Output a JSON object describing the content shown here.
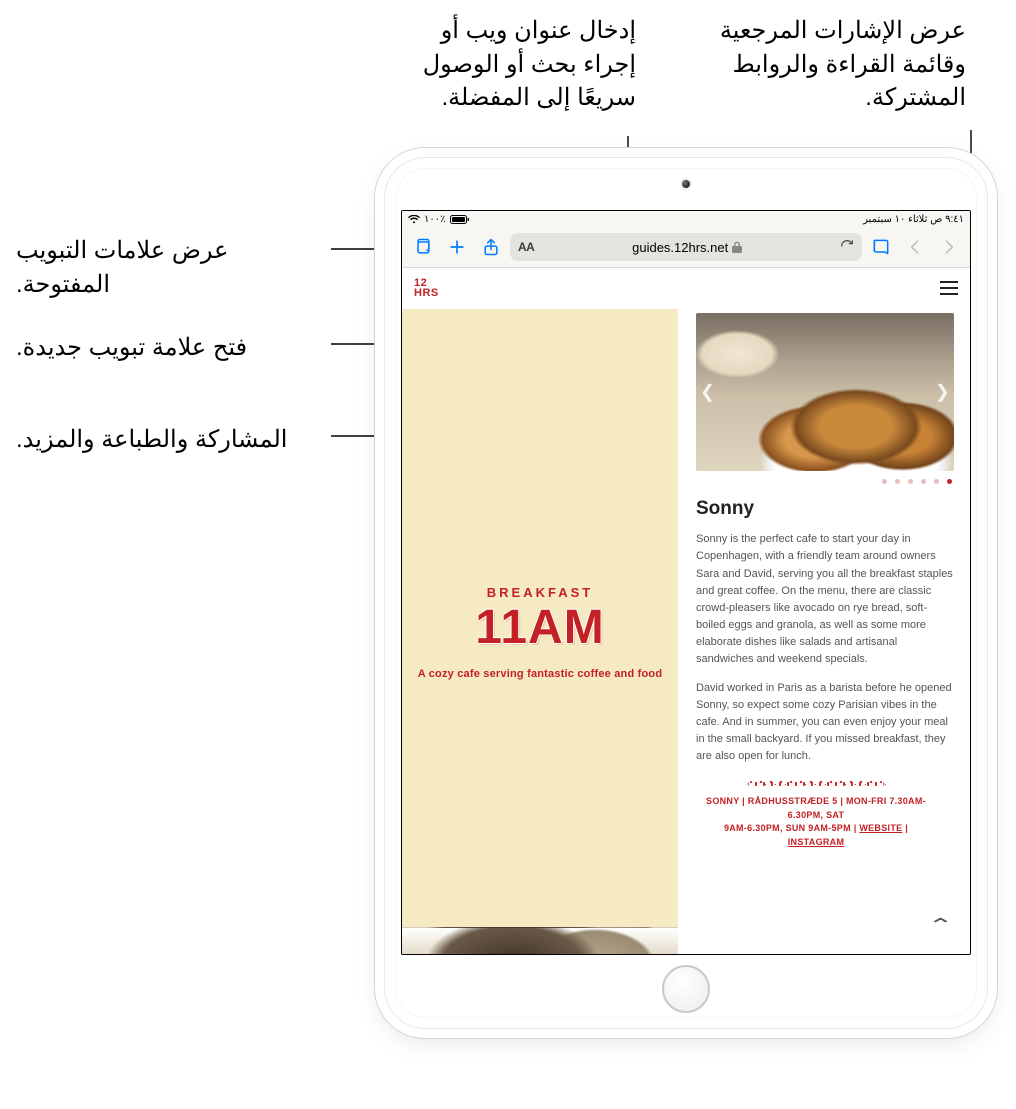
{
  "callouts": {
    "bookmarks": "عرض الإشارات المرجعية وقائمة القراءة والروابط المشتركة.",
    "urlbar": "إدخال عنوان ويب أو إجراء بحث أو الوصول سريعًا إلى المفضلة.",
    "tabs": "عرض علامات التبويب المفتوحة.",
    "newtab": "فتح علامة تبويب جديدة.",
    "share": "المشاركة والطباعة والمزيد."
  },
  "status": {
    "time": "٩:٤١ ص  ثلاثاء ١٠ سبتمبر",
    "battery": "١٠٠٪"
  },
  "urlbar": {
    "aa": "AA",
    "address": "guides.12hrs.net"
  },
  "site": {
    "logo_top": "12",
    "logo_bottom": "HRS"
  },
  "left": {
    "tag": "BREAKFAST",
    "headline": "11AM",
    "sub": "A cozy cafe serving fantastic coffee and food"
  },
  "article": {
    "title": "Sonny",
    "p1": "Sonny is the perfect cafe to start your day in Copenhagen, with a friendly team around owners Sara and David, serving you all the breakfast staples and great coffee. On the menu, there are classic crowd-pleasers like avocado on rye bread, soft-boiled eggs and granola, as well as some more elaborate dishes like salads and artisanal sandwiches and weekend specials.",
    "p2": "David worked in Paris as a barista before he opened Sonny, so expect some cozy Parisian vibes in the cafe. And in summer, you can even enjoy your meal in the small backyard. If you missed breakfast, they are also open for lunch."
  },
  "infoline": {
    "name": "SONNY",
    "address": "RÅDHUSSTRÆDE 5",
    "hours1": "MON-FRI 7.30AM-6.30PM, SAT",
    "hours2": "9AM-6.30PM, SUN 9AM-5PM",
    "website": "WEBSITE",
    "instagram": "INSTAGRAM"
  }
}
